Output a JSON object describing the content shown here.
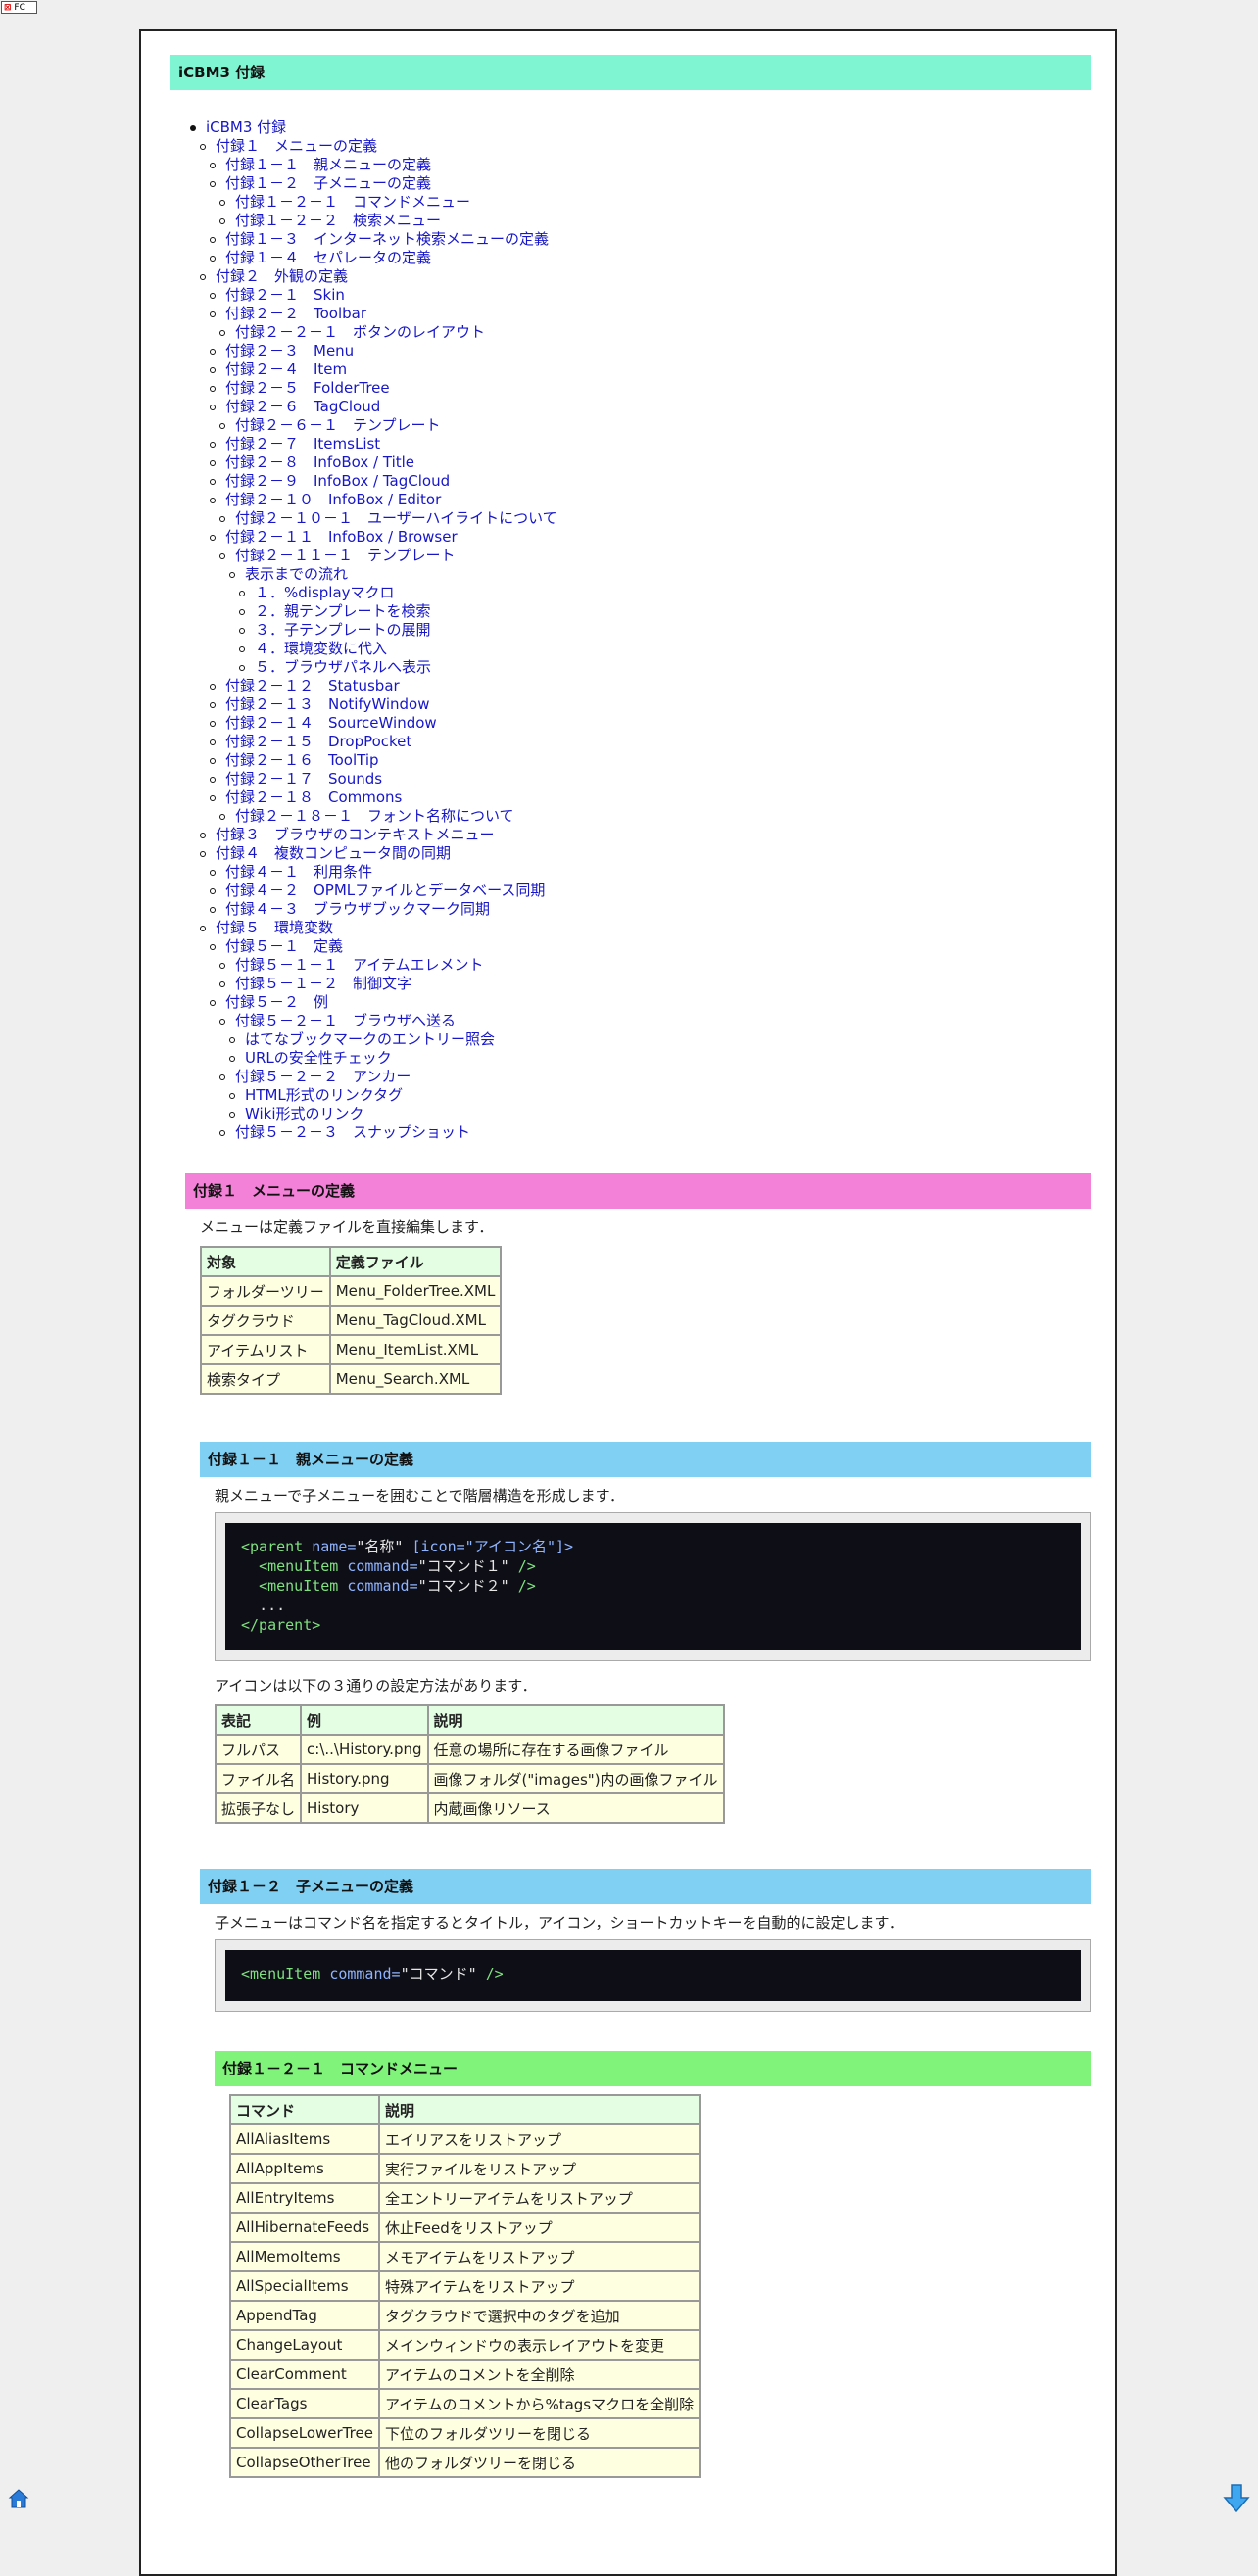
{
  "badge": {
    "prefix": "FC"
  },
  "doc": {
    "title": "iCBM3 付録"
  },
  "toc": [
    {
      "label": "iCBM3 付録",
      "level": 0
    },
    {
      "label": "付録１　メニューの定義",
      "level": 1
    },
    {
      "label": "付録１－１　親メニューの定義",
      "level": 2
    },
    {
      "label": "付録１－２　子メニューの定義",
      "level": 2
    },
    {
      "label": "付録１－２－１　コマンドメニュー",
      "level": 3
    },
    {
      "label": "付録１－２－２　検索メニュー",
      "level": 3
    },
    {
      "label": "付録１－３　インターネット検索メニューの定義",
      "level": 2
    },
    {
      "label": "付録１－４　セパレータの定義",
      "level": 2
    },
    {
      "label": "付録２　外観の定義",
      "level": 1
    },
    {
      "label": "付録２－１　Skin",
      "level": 2
    },
    {
      "label": "付録２－２　Toolbar",
      "level": 2
    },
    {
      "label": "付録２－２－１　ボタンのレイアウト",
      "level": 3
    },
    {
      "label": "付録２－３　Menu",
      "level": 2
    },
    {
      "label": "付録２－４　Item",
      "level": 2
    },
    {
      "label": "付録２－５　FolderTree",
      "level": 2
    },
    {
      "label": "付録２－６　TagCloud",
      "level": 2
    },
    {
      "label": "付録２－６－１　テンプレート",
      "level": 3
    },
    {
      "label": "付録２－７　ItemsList",
      "level": 2
    },
    {
      "label": "付録２－８　InfoBox / Title",
      "level": 2
    },
    {
      "label": "付録２－９　InfoBox / TagCloud",
      "level": 2
    },
    {
      "label": "付録２－１０　InfoBox / Editor",
      "level": 2
    },
    {
      "label": "付録２－１０－１　ユーザーハイライトについて",
      "level": 3
    },
    {
      "label": "付録２－１１　InfoBox / Browser",
      "level": 2
    },
    {
      "label": "付録２－１１－１　テンプレート",
      "level": 3
    },
    {
      "label": "表示までの流れ",
      "level": 4
    },
    {
      "label": "１．%displayマクロ",
      "level": 5
    },
    {
      "label": "２．親テンプレートを検索",
      "level": 5
    },
    {
      "label": "３．子テンプレートの展開",
      "level": 5
    },
    {
      "label": "４．環境変数に代入",
      "level": 5
    },
    {
      "label": "５．ブラウザパネルへ表示",
      "level": 5
    },
    {
      "label": "付録２－１２　Statusbar",
      "level": 2
    },
    {
      "label": "付録２－１３　NotifyWindow",
      "level": 2
    },
    {
      "label": "付録２－１４　SourceWindow",
      "level": 2
    },
    {
      "label": "付録２－１５　DropPocket",
      "level": 2
    },
    {
      "label": "付録２－１６　ToolTip",
      "level": 2
    },
    {
      "label": "付録２－１７　Sounds",
      "level": 2
    },
    {
      "label": "付録２－１８　Commons",
      "level": 2
    },
    {
      "label": "付録２－１８－１　フォント名称について",
      "level": 3
    },
    {
      "label": "付録３　ブラウザのコンテキストメニュー",
      "level": 1
    },
    {
      "label": "付録４　複数コンピュータ間の同期",
      "level": 1
    },
    {
      "label": "付録４－１　利用条件",
      "level": 2
    },
    {
      "label": "付録４－２　OPMLファイルとデータベース同期",
      "level": 2
    },
    {
      "label": "付録４－３　ブラウザブックマーク同期",
      "level": 2
    },
    {
      "label": "付録５　環境変数",
      "level": 1
    },
    {
      "label": "付録５－１　定義",
      "level": 2
    },
    {
      "label": "付録５－１－１　アイテムエレメント",
      "level": 3
    },
    {
      "label": "付録５－１－２　制御文字",
      "level": 3
    },
    {
      "label": "付録５－２　例",
      "level": 2
    },
    {
      "label": "付録５－２－１　ブラウザへ送る",
      "level": 3
    },
    {
      "label": "はてなブックマークのエントリー照会",
      "level": 4
    },
    {
      "label": "URLの安全性チェック",
      "level": 4
    },
    {
      "label": "付録５－２－２　アンカー",
      "level": 3
    },
    {
      "label": "HTML形式のリンクタグ",
      "level": 4
    },
    {
      "label": "Wiki形式のリンク",
      "level": 4
    },
    {
      "label": "付録５－２－３　スナップショット",
      "level": 3
    }
  ],
  "sec1": {
    "title": "付録１　メニューの定義",
    "intro": "メニューは定義ファイルを直接編集します．",
    "table": {
      "headers": [
        "対象",
        "定義ファイル"
      ],
      "rows": [
        [
          "フォルダーツリー",
          "Menu_FolderTree.XML"
        ],
        [
          "タグクラウド",
          "Menu_TagCloud.XML"
        ],
        [
          "アイテムリスト",
          "Menu_ItemList.XML"
        ],
        [
          "検索タイプ",
          "Menu_Search.XML"
        ]
      ]
    }
  },
  "sec11": {
    "title": "付録１－１　親メニューの定義",
    "intro": "親メニューで子メニューを囲むことで階層構造を形成します．",
    "code": {
      "l1_open": "<parent",
      "l1_attr1": "name=",
      "l1_val1": "\"名称\"",
      "l1_rest": " [icon=\"アイコン名\"]>",
      "l2_tag": "<menuItem",
      "l2_attr": "command=",
      "l2_val": "\"コマンド１\"",
      "l2_end": " />",
      "l3_tag": "<menuItem",
      "l3_attr": "command=",
      "l3_val": "\"コマンド２\"",
      "l3_end": " />",
      "l4": "...",
      "l5": "</parent>"
    },
    "icon_intro": "アイコンは以下の３通りの設定方法があります．",
    "icon_table": {
      "headers": [
        "表記",
        "例",
        "説明"
      ],
      "rows": [
        [
          "フルパス",
          "c:\\..\\History.png",
          "任意の場所に存在する画像ファイル"
        ],
        [
          "ファイル名",
          "History.png",
          "画像フォルダ(\"images\")内の画像ファイル"
        ],
        [
          "拡張子なし",
          "History",
          "内蔵画像リソース"
        ]
      ]
    }
  },
  "sec12": {
    "title": "付録１－２　子メニューの定義",
    "intro": "子メニューはコマンド名を指定するとタイトル，アイコン，ショートカットキーを自動的に設定します．",
    "code": {
      "tag": "<menuItem",
      "attr": "command=",
      "val": "\"コマンド\"",
      "end": " />"
    }
  },
  "sec121": {
    "title": "付録１－２－１　コマンドメニュー",
    "table": {
      "headers": [
        "コマンド",
        "説明"
      ],
      "rows": [
        [
          "AllAliasItems",
          "エイリアスをリストアップ"
        ],
        [
          "AllAppItems",
          "実行ファイルをリストアップ"
        ],
        [
          "AllEntryItems",
          "全エントリーアイテムをリストアップ"
        ],
        [
          "AllHibernateFeeds",
          "休止Feedをリストアップ"
        ],
        [
          "AllMemoItems",
          "メモアイテムをリストアップ"
        ],
        [
          "AllSpecialItems",
          "特殊アイテムをリストアップ"
        ],
        [
          "AppendTag",
          "タグクラウドで選択中のタグを追加"
        ],
        [
          "ChangeLayout",
          "メインウィンドウの表示レイアウトを変更"
        ],
        [
          "ClearComment",
          "アイテムのコメントを全削除"
        ],
        [
          "ClearTags",
          "アイテムのコメントから%tagsマクロを全削除"
        ],
        [
          "CollapseLowerTree",
          "下位のフォルダツリーを閉じる"
        ],
        [
          "CollapseOtherTree",
          "他のフォルダツリーを閉じる"
        ]
      ]
    }
  }
}
